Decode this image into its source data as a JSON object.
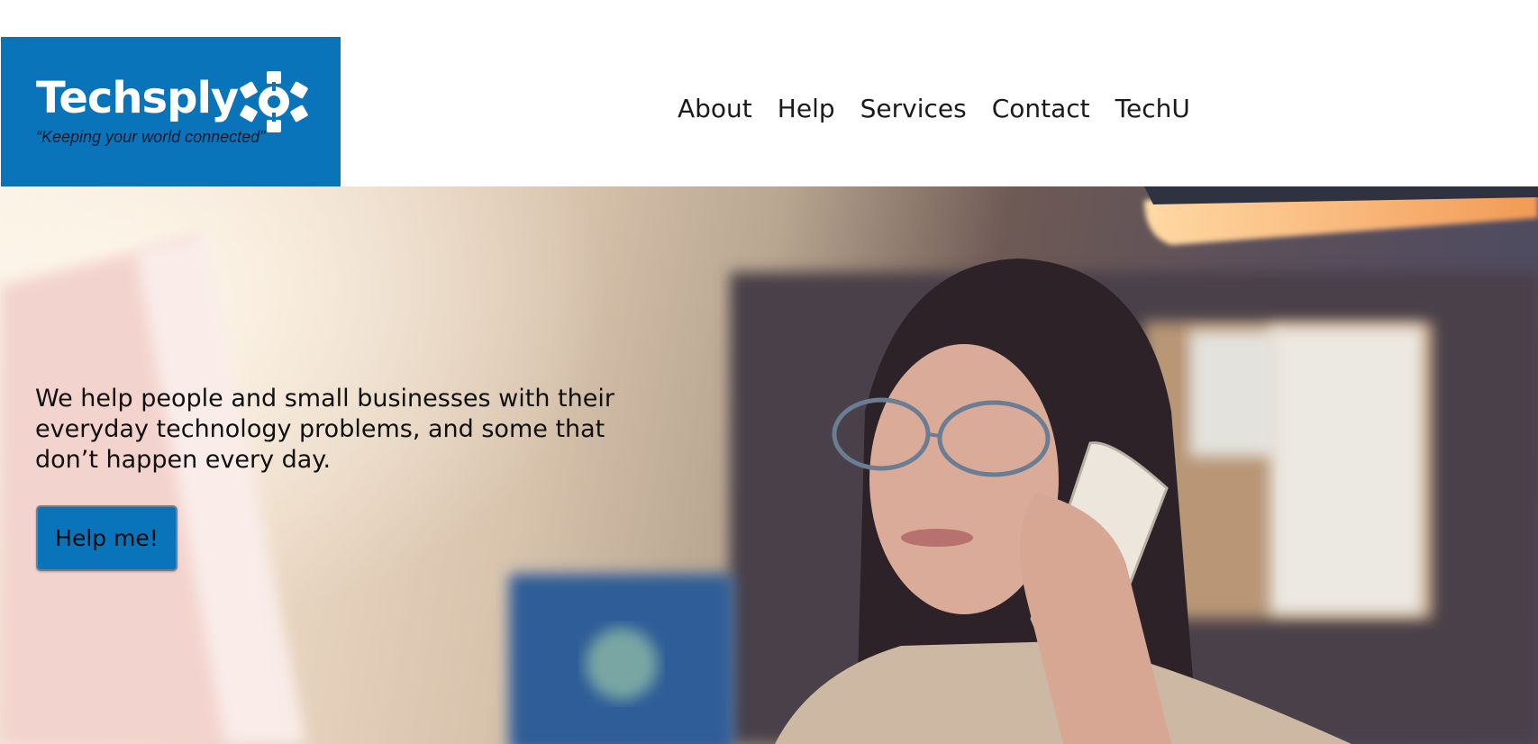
{
  "brand": {
    "name": "Techsply",
    "tagline": "“Keeping your world connected”",
    "color": "#0a74bb",
    "mark_icon": "connected-network-icon"
  },
  "nav": {
    "items": [
      "About",
      "Help",
      "Services",
      "Contact",
      "TechU"
    ]
  },
  "hero": {
    "headline": "We help people and small businesses with their everyday technology problems, and some that don’t happen every day.",
    "cta_label": "Help me!",
    "image_subject": "hero-photo"
  }
}
